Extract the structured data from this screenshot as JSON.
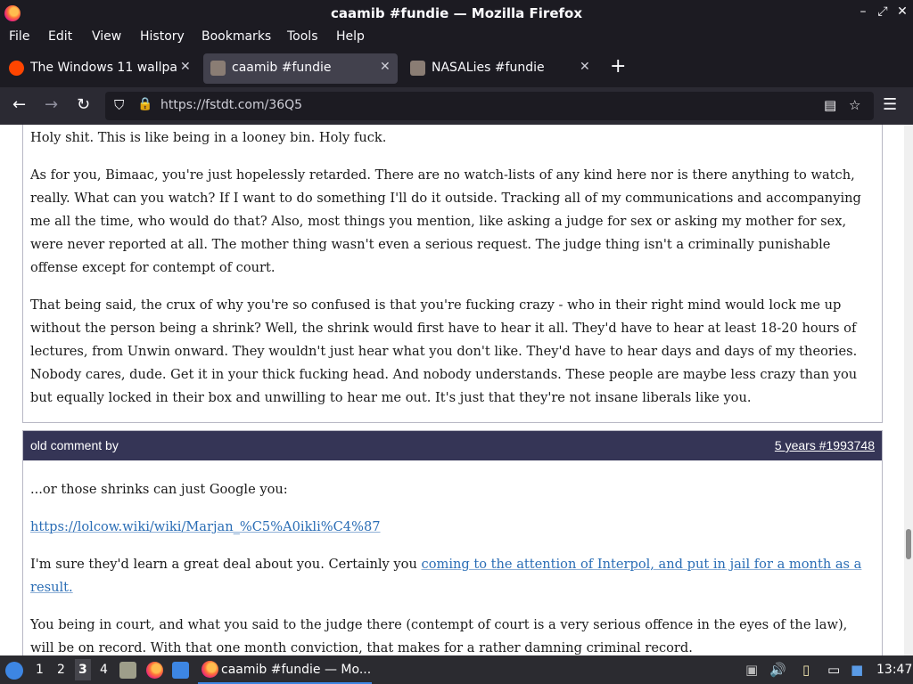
{
  "window": {
    "title": "caamib #fundie — Mozilla Firefox"
  },
  "menu": {
    "items": [
      "File",
      "Edit",
      "View",
      "History",
      "Bookmarks",
      "Tools",
      "Help"
    ]
  },
  "tabs": [
    {
      "label": "The Windows 11 wallpap",
      "active": false
    },
    {
      "label": "caamib #fundie",
      "active": true
    },
    {
      "label": "NASALies #fundie",
      "active": false
    }
  ],
  "nav": {
    "url": "https://fstdt.com/36Q5"
  },
  "content": {
    "comment1": {
      "paragraphs": [
        "Holy shit. This is like being in a looney bin. Holy fuck.",
        "As for you, Bimaac, you're just hopelessly retarded. There are no watch-lists of any kind here nor is there anything to watch, really. What can you watch? If I want to do something I'll do it outside. Tracking all of my communications and accompanying me all the time, who would do that? Also, most things you mention, like asking a judge for sex or asking my mother for sex, were never reported at all. The mother thing wasn't even a serious request. The judge thing isn't a criminally punishable offense except for contempt of court.",
        "That being said, the crux of why you're so confused is that you're fucking crazy - who in their right mind would lock me up without the person being a shrink? Well, the shrink would first have to hear it all. They'd have to hear at least 18-20 hours of lectures, from Unwin onward. They wouldn't just hear what you don't like. They'd have to hear days and days of my theories. Nobody cares, dude. Get it in your thick fucking head. And nobody understands. These people are maybe less crazy than you but equally locked in their box and unwilling to hear me out. It's just that they're not insane liberals like you."
      ]
    },
    "comment2": {
      "header_by": "old comment by",
      "header_meta": "5 years #1993748",
      "p1": "...or those shrinks can just Google you:",
      "link1": "https://lolcow.wiki/wiki/Marjan_%C5%A0ikli%C4%87",
      "p2_prefix": "I'm sure they'd learn a great deal about you. Certainly you ",
      "p2_link": "coming to the attention of Interpol, and put in jail for a month as a result.",
      "p3": "You being in court, and what you said to the judge there (contempt of court is a very serious offence in the eyes of the law), will be on record. With that one month conviction, that makes for a rather damning criminal record."
    }
  },
  "taskbar": {
    "workspaces": [
      "1",
      "2",
      "3",
      "4"
    ],
    "current_workspace": "3",
    "task_label": "caamib #fundie — Mo...",
    "clock": "13:47"
  }
}
